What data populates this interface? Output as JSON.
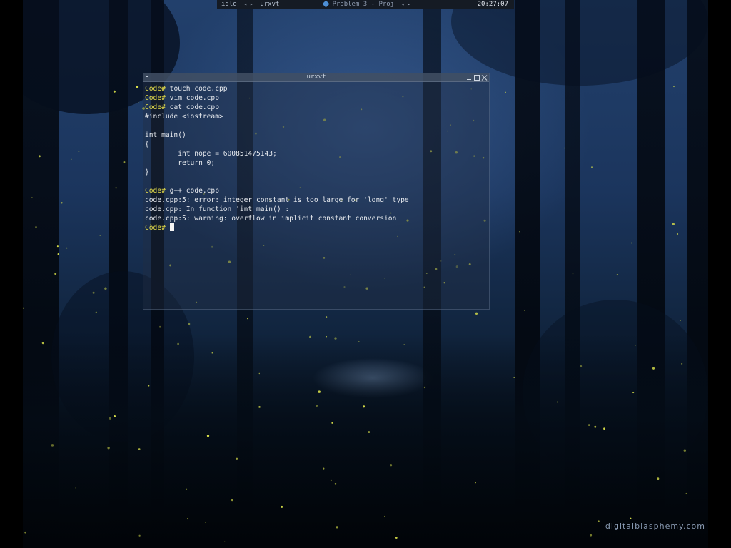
{
  "topbar": {
    "status": "idle",
    "window": "urxvt",
    "project": "Problem 3 - Proj",
    "clock": "20:27:07"
  },
  "terminal": {
    "title": "urxvt",
    "prompt": "Code#",
    "lines": [
      {
        "prompt": true,
        "text": " touch code.cpp"
      },
      {
        "prompt": true,
        "text": " vim code.cpp"
      },
      {
        "prompt": true,
        "text": " cat code.cpp"
      },
      {
        "prompt": false,
        "text": "#include <iostream>"
      },
      {
        "prompt": false,
        "text": ""
      },
      {
        "prompt": false,
        "text": "int main()"
      },
      {
        "prompt": false,
        "text": "{"
      },
      {
        "prompt": false,
        "text": "        int nope = 600851475143;"
      },
      {
        "prompt": false,
        "text": "        return 0;"
      },
      {
        "prompt": false,
        "text": "}"
      },
      {
        "prompt": false,
        "text": ""
      },
      {
        "prompt": true,
        "text": " g++ code.cpp"
      },
      {
        "prompt": false,
        "text": "code.cpp:5: error: integer constant is too large for 'long' type"
      },
      {
        "prompt": false,
        "text": "code.cpp: In function 'int main()':"
      },
      {
        "prompt": false,
        "text": "code.cpp:5: warning: overflow in implicit constant conversion"
      },
      {
        "prompt": true,
        "text": " ",
        "cursor": true
      }
    ]
  },
  "wallpaper": {
    "watermark": "digitalblasphemy.com"
  },
  "colors": {
    "prompt": "#e8e04a",
    "firefly": "#d9e04a",
    "panel": "#151b24"
  }
}
